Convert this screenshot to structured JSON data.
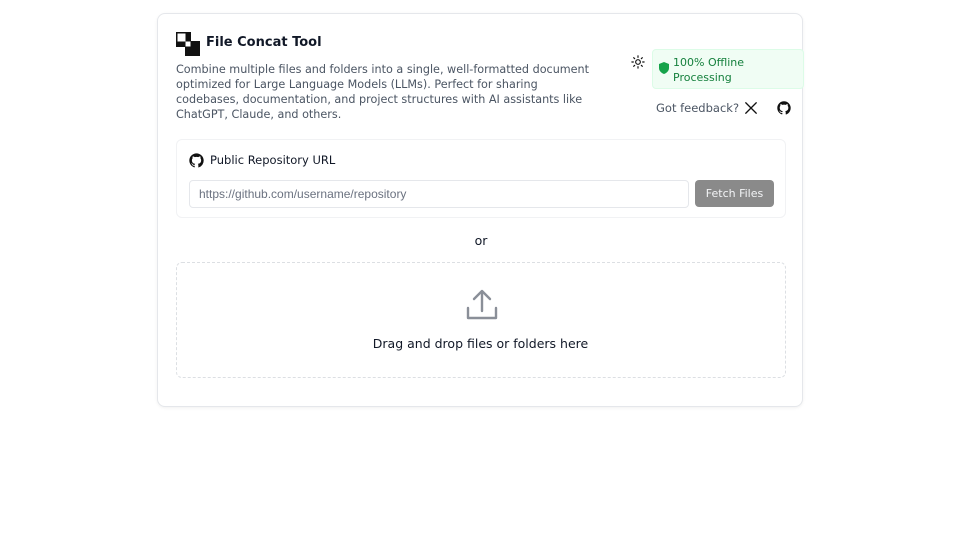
{
  "header": {
    "title": "File Concat Tool",
    "logo_icon": "overlapping-squares-logo-icon",
    "description": "Combine multiple files and folders into a single, well-formatted document optimized for Large Language Models (LLMs). Perfect for sharing codebases, documentation, and project structures with AI assistants like ChatGPT, Claude, and others."
  },
  "toolbar": {
    "theme_icon": "sun-icon",
    "offline_badge": "100% Offline Processing",
    "offline_icon": "shield-icon",
    "feedback_label": "Got feedback?",
    "x_icon": "x-logo-icon",
    "github_icon": "github-icon"
  },
  "repository": {
    "label": "Public Repository URL",
    "input_placeholder": "https://github.com/username/repository",
    "input_value": "",
    "fetch_label": "Fetch Files"
  },
  "separator": "or",
  "dropzone": {
    "label": "Drag and drop files or folders here",
    "icon": "upload-icon"
  },
  "colors": {
    "badge_bg": "#f0fdf4",
    "badge_text": "#15803d",
    "button_bg": "#8a8a8a"
  }
}
